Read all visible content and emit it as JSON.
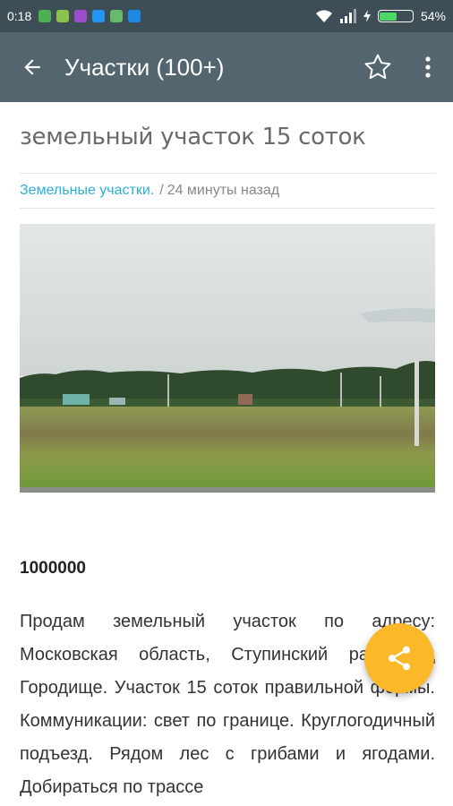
{
  "status_bar": {
    "time": "0:18",
    "battery_percent": "54%",
    "battery_level": 0.54,
    "notification_icons": [
      "download-icon",
      "app-icon",
      "viber-icon",
      "app-icon",
      "app-icon",
      "cloud-icon"
    ]
  },
  "app_bar": {
    "title": "Участки (100+)",
    "back_icon": "arrow-left-icon",
    "favorite_icon": "star-outline-icon",
    "menu_icon": "more-vert-icon"
  },
  "post": {
    "title": "земельный участок 15 соток",
    "category": "Земельные участки.",
    "separator": "/",
    "time_ago": "24 минуты назад",
    "price": "1000000",
    "description": "Продам земельный участок по адресу: Московская область, Ступинский район, д Городище. Участок 15 соток правильной формы. Коммуникации: свет по границе. Круглогодичный подъезд. Рядом лес с грибами и ягодами. Добираться по трассе"
  },
  "fab": {
    "icon": "share-icon"
  },
  "colors": {
    "status_bar": "#3e4e57",
    "app_bar": "#53656f",
    "link": "#2db0d6",
    "fab": "#fbb829"
  }
}
